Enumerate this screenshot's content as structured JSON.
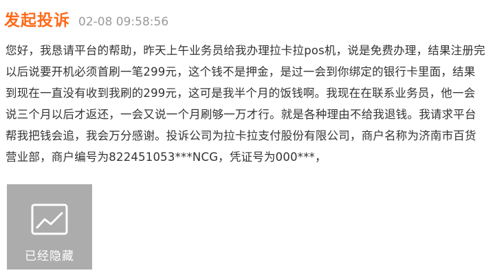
{
  "complaint": {
    "title": "发起投诉",
    "timestamp": "02-08 09:58:56",
    "body": "您好，我恳请平台的帮助，昨天上午业务员给我办理拉卡拉pos机，说是免费办理，结果注册完以后说要开机必须首刷一笔299元，这个钱不是押金，是过一会到你绑定的银行卡里面，结果到现在一直没有收到我刷的299元，这可是我半个月的饭钱啊。我现在在联系业务员，他一会说三个月以后才返还，一会又说一个月刷够一万才行。就是各种理由不给我退钱。我请求平台帮我把钱会追，我会万分感谢。投诉公司为拉卡拉支付股份有限公司，商户名称为济南市百货营业部，商户编号为822451053***NCG，凭证号为000***，"
  },
  "attachment": {
    "icon": "image-icon",
    "label": "已经隐藏"
  },
  "colors": {
    "title": "#ff6a1a",
    "timestamp": "#9a9a9a",
    "body_text": "#333333",
    "hidden_card_bg": "#acacac"
  }
}
